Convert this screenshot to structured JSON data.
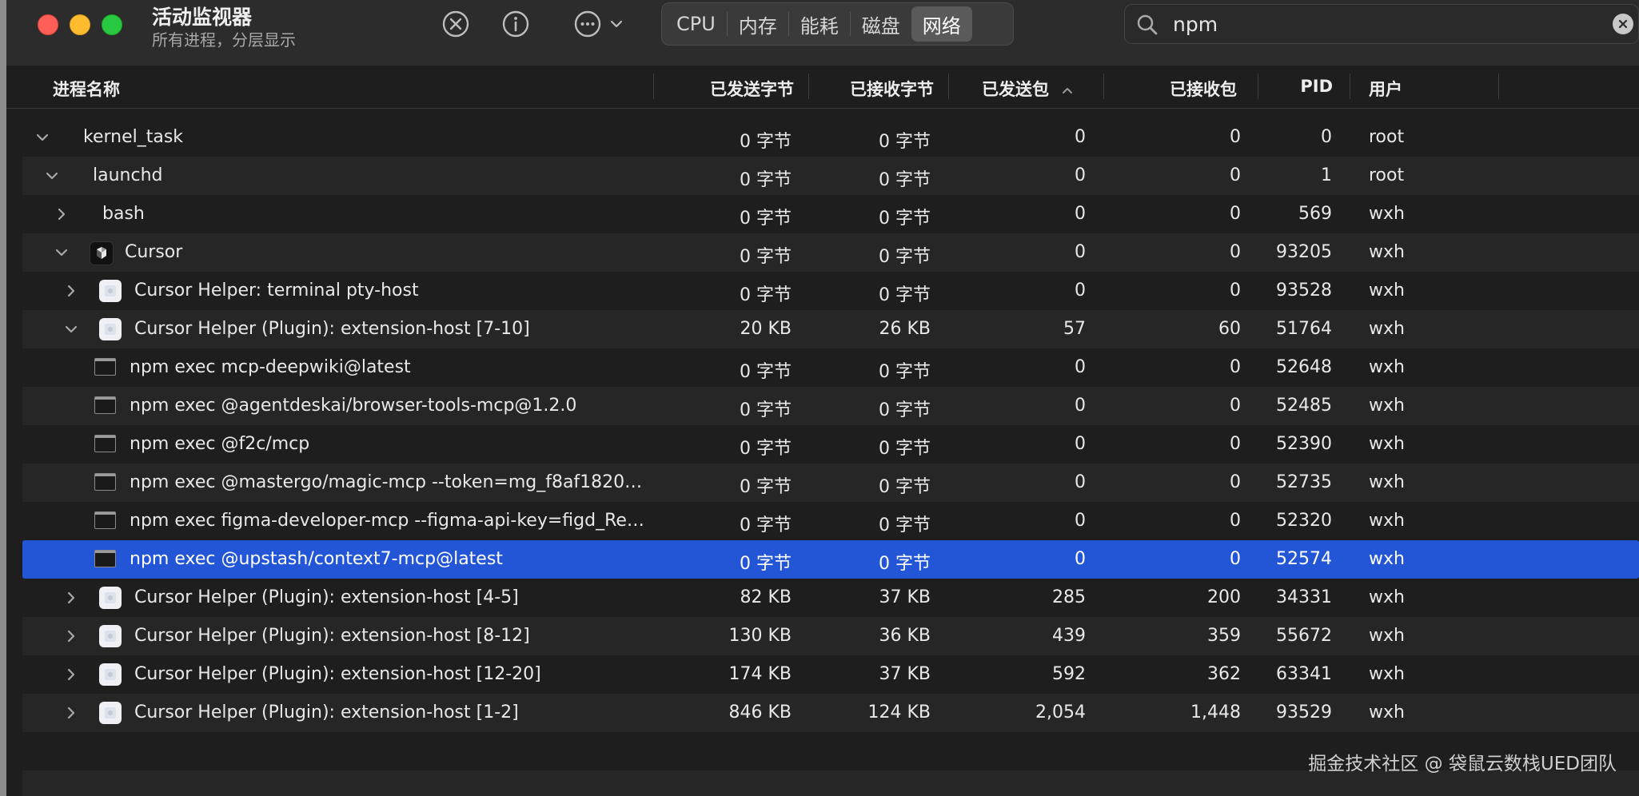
{
  "window": {
    "title": "活动监视器",
    "subtitle": "所有进程，分层显示"
  },
  "toolbar": {
    "stop_icon": "stop-x-circle-icon",
    "info_icon": "info-circle-icon",
    "more_icon": "ellipsis-circle-icon",
    "tabs": [
      {
        "label": "CPU",
        "selected": false
      },
      {
        "label": "内存",
        "selected": false
      },
      {
        "label": "能耗",
        "selected": false
      },
      {
        "label": "磁盘",
        "selected": false
      },
      {
        "label": "网络",
        "selected": true
      }
    ]
  },
  "search": {
    "value": "npm"
  },
  "columns": {
    "name": "进程名称",
    "bytes_sent": "已发送字节",
    "bytes_received": "已接收字节",
    "packets_sent": "已发送包",
    "packets_received": "已接收包",
    "pid": "PID",
    "user": "用户",
    "sorted_by": "packets_sent",
    "sort_direction": "ascending"
  },
  "rows": [
    {
      "name": "kernel_task",
      "level": 0,
      "expand": "open",
      "icon": "",
      "bytes_sent": "0 字节",
      "bytes_received": "0 字节",
      "packets_sent": "0",
      "packets_received": "0",
      "pid": "0",
      "user": "root"
    },
    {
      "name": "launchd",
      "level": 1,
      "expand": "open",
      "icon": "",
      "bytes_sent": "0 字节",
      "bytes_received": "0 字节",
      "packets_sent": "0",
      "packets_received": "0",
      "pid": "1",
      "user": "root"
    },
    {
      "name": "bash",
      "level": 2,
      "expand": "closed",
      "icon": "",
      "bytes_sent": "0 字节",
      "bytes_received": "0 字节",
      "packets_sent": "0",
      "packets_received": "0",
      "pid": "569",
      "user": "wxh"
    },
    {
      "name": "Cursor",
      "level": 2,
      "expand": "open",
      "icon": "cursor",
      "bytes_sent": "0 字节",
      "bytes_received": "0 字节",
      "packets_sent": "0",
      "packets_received": "0",
      "pid": "93205",
      "user": "wxh"
    },
    {
      "name": "Cursor Helper: terminal pty-host",
      "level": 3,
      "expand": "closed",
      "icon": "helper",
      "bytes_sent": "0 字节",
      "bytes_received": "0 字节",
      "packets_sent": "0",
      "packets_received": "0",
      "pid": "93528",
      "user": "wxh"
    },
    {
      "name": "Cursor Helper (Plugin): extension-host [7-10]",
      "level": 3,
      "expand": "open",
      "icon": "helper",
      "bytes_sent": "20 KB",
      "bytes_received": "26 KB",
      "packets_sent": "57",
      "packets_received": "60",
      "pid": "51764",
      "user": "wxh"
    },
    {
      "name": "npm exec mcp-deepwiki@latest",
      "level": 4,
      "expand": "none",
      "icon": "term",
      "bytes_sent": "0 字节",
      "bytes_received": "0 字节",
      "packets_sent": "0",
      "packets_received": "0",
      "pid": "52648",
      "user": "wxh"
    },
    {
      "name": "npm exec @agentdeskai/browser-tools-mcp@1.2.0",
      "level": 4,
      "expand": "none",
      "icon": "term",
      "bytes_sent": "0 字节",
      "bytes_received": "0 字节",
      "packets_sent": "0",
      "packets_received": "0",
      "pid": "52485",
      "user": "wxh"
    },
    {
      "name": "npm exec @f2c/mcp",
      "level": 4,
      "expand": "none",
      "icon": "term",
      "bytes_sent": "0 字节",
      "bytes_received": "0 字节",
      "packets_sent": "0",
      "packets_received": "0",
      "pid": "52390",
      "user": "wxh"
    },
    {
      "name": "npm exec @mastergo/magic-mcp --token=mg_f8af1820b...",
      "level": 4,
      "expand": "none",
      "icon": "term",
      "bytes_sent": "0 字节",
      "bytes_received": "0 字节",
      "packets_sent": "0",
      "packets_received": "0",
      "pid": "52735",
      "user": "wxh"
    },
    {
      "name": "npm exec figma-developer-mcp --figma-api-key=figd_Rel...",
      "level": 4,
      "expand": "none",
      "icon": "term",
      "bytes_sent": "0 字节",
      "bytes_received": "0 字节",
      "packets_sent": "0",
      "packets_received": "0",
      "pid": "52320",
      "user": "wxh"
    },
    {
      "name": "npm exec @upstash/context7-mcp@latest",
      "level": 4,
      "expand": "none",
      "icon": "term",
      "selected": true,
      "bytes_sent": "0 字节",
      "bytes_received": "0 字节",
      "packets_sent": "0",
      "packets_received": "0",
      "pid": "52574",
      "user": "wxh"
    },
    {
      "name": "Cursor Helper (Plugin): extension-host [4-5]",
      "level": 3,
      "expand": "closed",
      "icon": "helper",
      "bytes_sent": "82 KB",
      "bytes_received": "37 KB",
      "packets_sent": "285",
      "packets_received": "200",
      "pid": "34331",
      "user": "wxh"
    },
    {
      "name": "Cursor Helper (Plugin): extension-host [8-12]",
      "level": 3,
      "expand": "closed",
      "icon": "helper",
      "bytes_sent": "130 KB",
      "bytes_received": "36 KB",
      "packets_sent": "439",
      "packets_received": "359",
      "pid": "55672",
      "user": "wxh"
    },
    {
      "name": "Cursor Helper (Plugin): extension-host [12-20]",
      "level": 3,
      "expand": "closed",
      "icon": "helper",
      "bytes_sent": "174 KB",
      "bytes_received": "37 KB",
      "packets_sent": "592",
      "packets_received": "362",
      "pid": "63341",
      "user": "wxh"
    },
    {
      "name": "Cursor Helper (Plugin): extension-host [1-2]",
      "level": 3,
      "expand": "closed",
      "icon": "helper",
      "bytes_sent": "846 KB",
      "bytes_received": "124 KB",
      "packets_sent": "2,054",
      "packets_received": "1,448",
      "pid": "93529",
      "user": "wxh"
    }
  ],
  "colors": {
    "selection": "#2356d6",
    "close": "#ff5f57",
    "minimize": "#febc2e",
    "zoom": "#28c840"
  },
  "watermark": "掘金技术社区 @ 袋鼠云数栈UED团队"
}
